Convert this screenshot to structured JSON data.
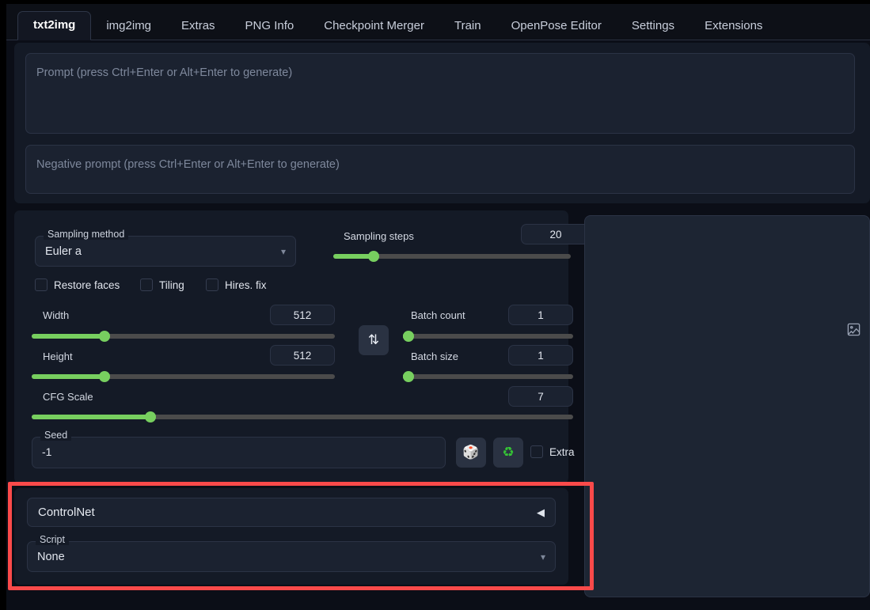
{
  "app": {
    "accent_green": "#77cf5f",
    "highlight_color": "#fa4a4a",
    "panel_bg": "#141a26",
    "field_bg": "#1b2230"
  },
  "tabs": [
    {
      "label": "txt2img",
      "active": true
    },
    {
      "label": "img2img",
      "active": false
    },
    {
      "label": "Extras",
      "active": false
    },
    {
      "label": "PNG Info",
      "active": false
    },
    {
      "label": "Checkpoint Merger",
      "active": false
    },
    {
      "label": "Train",
      "active": false
    },
    {
      "label": "OpenPose Editor",
      "active": false
    },
    {
      "label": "Settings",
      "active": false
    },
    {
      "label": "Extensions",
      "active": false
    }
  ],
  "prompt": {
    "positive_placeholder": "Prompt (press Ctrl+Enter or Alt+Enter to generate)",
    "positive_value": "",
    "negative_placeholder": "Negative prompt (press Ctrl+Enter or Alt+Enter to generate)",
    "negative_value": ""
  },
  "settings": {
    "sampling_method": {
      "label": "Sampling method",
      "value": "Euler a",
      "caret": "chevron-down-icon"
    },
    "sampling_steps": {
      "label": "Sampling steps",
      "value": "20",
      "fill_pct": 17
    },
    "checkboxes": [
      {
        "label": "Restore faces",
        "checked": false
      },
      {
        "label": "Tiling",
        "checked": false
      },
      {
        "label": "Hires. fix",
        "checked": false
      }
    ],
    "width": {
      "label": "Width",
      "value": "512",
      "fill_pct": 24
    },
    "height": {
      "label": "Height",
      "value": "512",
      "fill_pct": 24
    },
    "cfg_scale": {
      "label": "CFG Scale",
      "value": "7",
      "fill_pct": 22
    },
    "batch_count": {
      "label": "Batch count",
      "value": "1",
      "fill_pct": 2
    },
    "batch_size": {
      "label": "Batch size",
      "value": "1",
      "fill_pct": 2
    },
    "swap_button": {
      "glyph": "⇅",
      "icon": "swap-dimensions-icon"
    },
    "seed": {
      "label": "Seed",
      "value": "-1",
      "dice_glyph": "🎲",
      "recycle_glyph": "♻",
      "extra_label": "Extra",
      "extra_checked": false
    }
  },
  "controlnet": {
    "title": "ControlNet",
    "arrow_glyph": "◀",
    "script": {
      "label": "Script",
      "value": "None",
      "caret": "chevron-down-icon"
    }
  },
  "gallery": {
    "placeholder_icon": "image-placeholder-icon"
  }
}
